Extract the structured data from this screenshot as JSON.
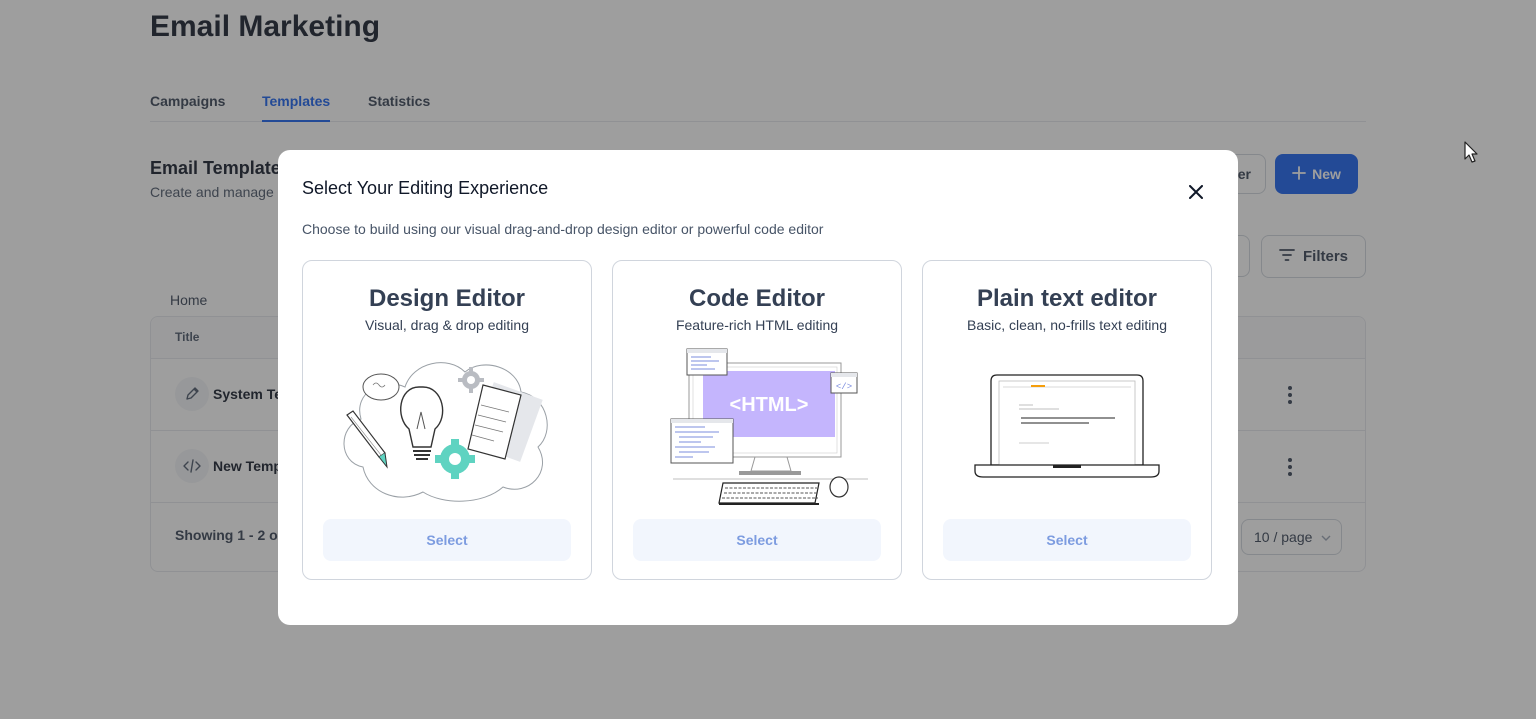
{
  "page": {
    "title": "Email Marketing",
    "tabs": [
      {
        "label": "Campaigns",
        "active": false
      },
      {
        "label": "Templates",
        "active": true
      },
      {
        "label": "Statistics",
        "active": false
      }
    ],
    "section_title": "Email Templates",
    "section_subtitle": "Create and manage",
    "partial_button_label": "er",
    "new_button_label": "New",
    "filters_button_label": "Filters",
    "breadcrumb": "Home",
    "table": {
      "column_title": "Title",
      "rows": [
        {
          "icon": "pencil-icon",
          "title": "System Te"
        },
        {
          "icon": "code-icon",
          "title": "New Temp"
        }
      ],
      "showing_text": "Showing 1 - 2 o",
      "page_size": "10 / page"
    }
  },
  "modal": {
    "title": "Select Your Editing Experience",
    "description": "Choose to build using our visual drag-and-drop design editor or powerful code editor",
    "options": [
      {
        "title": "Design Editor",
        "subtitle": "Visual, drag & drop editing",
        "button": "Select",
        "illustration": "design-illustration"
      },
      {
        "title": "Code Editor",
        "subtitle": "Feature-rich HTML editing",
        "button": "Select",
        "illustration": "code-illustration",
        "illustration_text": "<HTML>"
      },
      {
        "title": "Plain text editor",
        "subtitle": "Basic, clean, no-frills text editing",
        "button": "Select",
        "illustration": "laptop-illustration"
      }
    ]
  },
  "colors": {
    "primary": "#155eef",
    "overlay": "#343434",
    "select_button_bg": "#f2f6fd",
    "select_button_text": "#7d9ce0",
    "html_box": "#c4b5fd",
    "gear_teal": "#5fd3c1"
  }
}
